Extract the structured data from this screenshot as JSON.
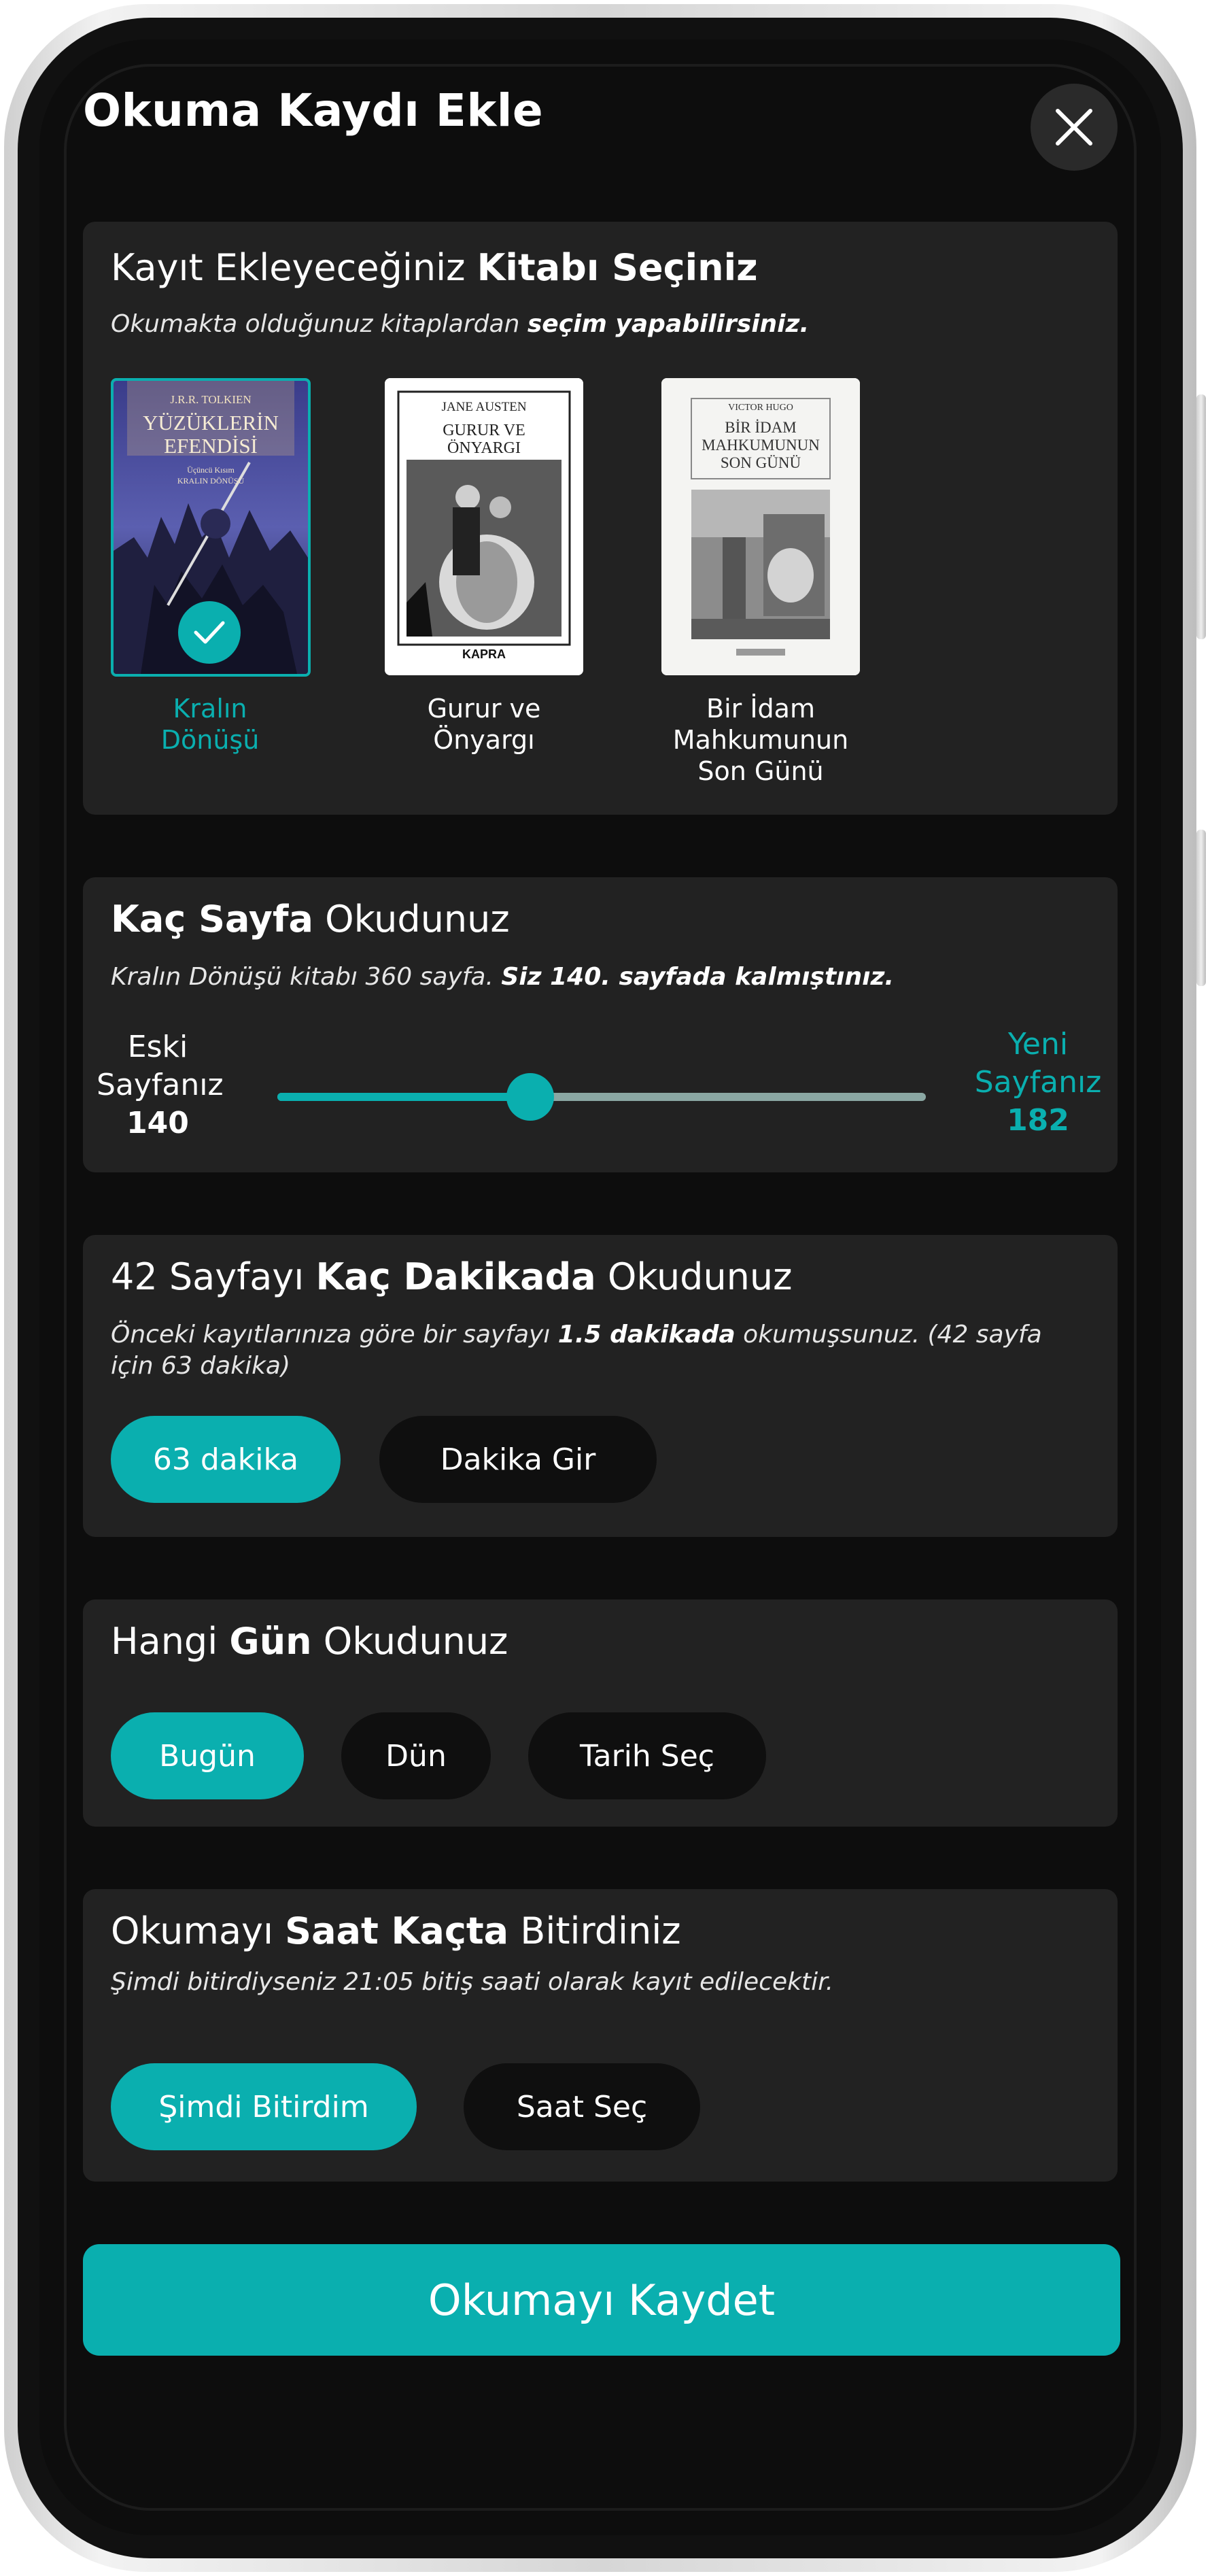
{
  "header": {
    "title": "Okuma Kaydı Ekle",
    "close_icon": "close-icon"
  },
  "colors": {
    "accent": "#0AAFAF",
    "card_bg": "#222222",
    "screen_bg": "#0D0D0D",
    "pill_bg": "#0F0F0F"
  },
  "book_section": {
    "title_plain": "Kayıt Ekleyeceğiniz ",
    "title_bold": "Kitabı Seçiniz",
    "subtitle_plain": "Okumakta olduğunuz kitaplardan ",
    "subtitle_bold": "seçim yapabilirsiniz.",
    "books": [
      {
        "label_line1": "Kralın",
        "label_line2": "Dönüşü",
        "selected": true,
        "cover": {
          "author": "J.R.R. TOLKIEN",
          "title_line1": "YÜZÜKLERİN",
          "title_line2": "EFENDİSİ",
          "sub_line1": "Üçüncü Kısım",
          "sub_line2": "KRALIN DÖNÜŞÜ"
        }
      },
      {
        "label_line1": "Gurur ve",
        "label_line2": "Önyargı",
        "selected": false,
        "cover": {
          "author": "JANE AUSTEN",
          "title_line1": "GURUR VE",
          "title_line2": "ÖNYARGI",
          "publisher": "KAPRA"
        }
      },
      {
        "label_line1": "Bir İdam",
        "label_line2": "Mahkumunun",
        "label_line3": "Son Günü",
        "selected": false,
        "cover": {
          "author": "VICTOR HUGO",
          "title_line1": "BİR İDAM",
          "title_line2": "MAHKUMUNUN",
          "title_line3": "SON GÜNÜ"
        }
      }
    ]
  },
  "pages_section": {
    "title_bold": "Kaç Sayfa",
    "title_plain": " Okudunuz",
    "subtitle_plain": "Kralın Dönüşü kitabı 360 sayfa. ",
    "subtitle_bold": "Siz 140. sayfada kalmıştınız.",
    "old_label_line1": "Eski",
    "old_label_line2": "Sayfanız",
    "old_page": "140",
    "new_label_line1": "Yeni",
    "new_label_line2": "Sayfanız",
    "new_page": "182",
    "slider_fraction": 0.39
  },
  "minutes_section": {
    "title_plain1": "42 Sayfayı ",
    "title_bold": "Kaç Dakikada",
    "title_plain2": " Okudunuz",
    "subtitle_plain1": "Önceki kayıtlarınıza göre bir sayfayı ",
    "subtitle_bold": "1.5 dakikada",
    "subtitle_plain2": " okumuşsunuz. (42 sayfa için 63 dakika)",
    "option_suggested": "63 dakika",
    "option_enter": "Dakika Gir"
  },
  "day_section": {
    "title_plain1": "Hangi ",
    "title_bold": "Gün",
    "title_plain2": " Okudunuz",
    "option_today": "Bugün",
    "option_yesterday": "Dün",
    "option_pick": "Tarih Seç"
  },
  "time_section": {
    "title_plain1": "Okumayı ",
    "title_bold": "Saat Kaçta",
    "title_plain2": " Bitirdiniz",
    "subtitle": "Şimdi bitirdiyseniz 21:05 bitiş saati olarak kayıt edilecektir.",
    "option_now": "Şimdi Bitirdim",
    "option_pick": "Saat Seç"
  },
  "save_button": {
    "label": "Okumayı Kaydet"
  }
}
